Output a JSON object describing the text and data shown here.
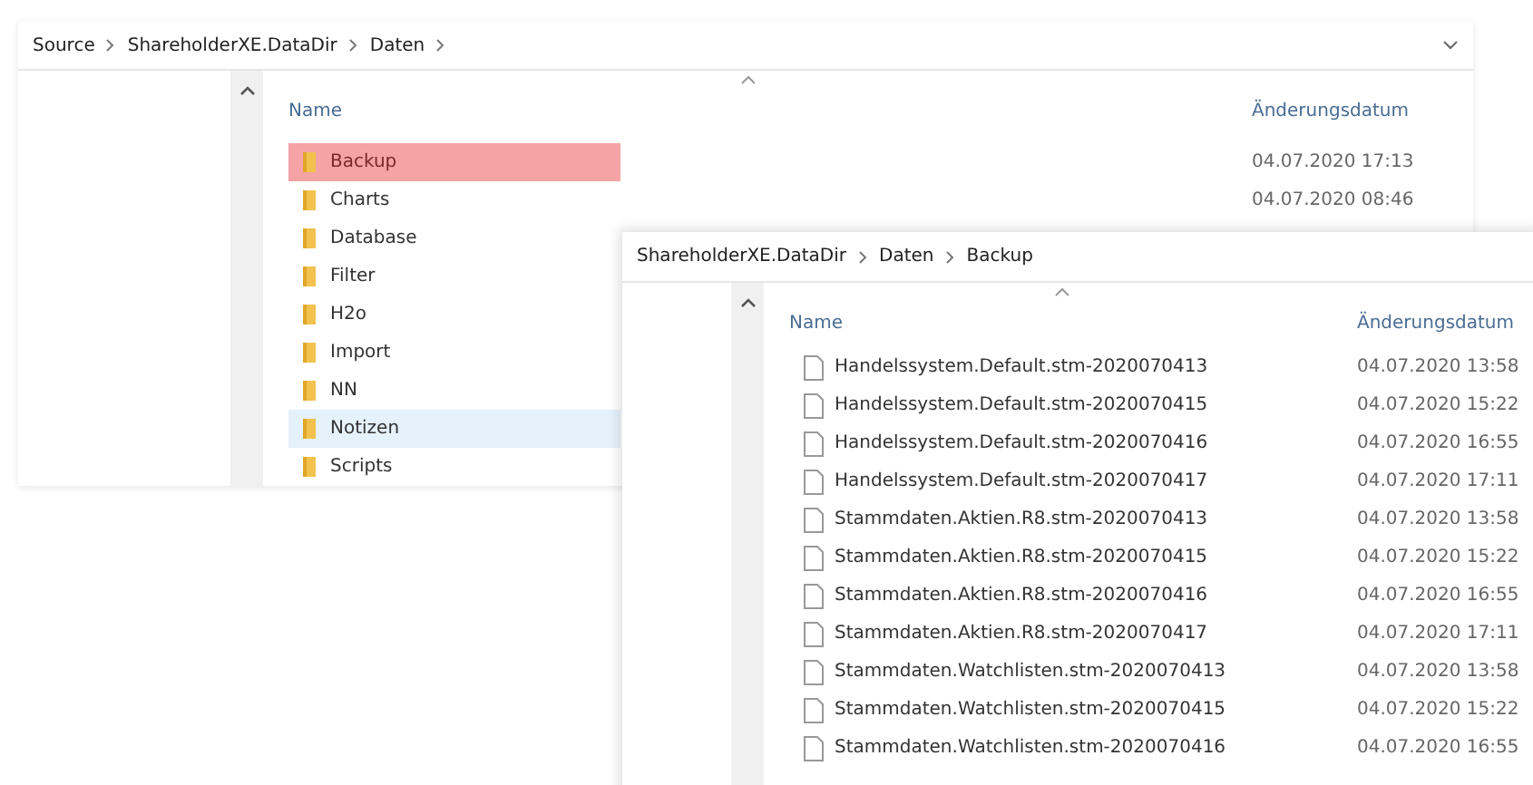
{
  "back_window": {
    "breadcrumb": [
      "Source",
      "ShareholderXE.DataDir",
      "Daten"
    ],
    "columns": [
      "Name",
      "Änderungsdatum"
    ],
    "folders": [
      {
        "name": "Backup",
        "marked": true,
        "selected": false
      },
      {
        "name": "Charts",
        "marked": false,
        "selected": false
      },
      {
        "name": "Database",
        "marked": false,
        "selected": false
      },
      {
        "name": "Filter",
        "marked": false,
        "selected": false
      },
      {
        "name": "H2o",
        "marked": false,
        "selected": false
      },
      {
        "name": "Import",
        "marked": false,
        "selected": false
      },
      {
        "name": "NN",
        "marked": false,
        "selected": false
      },
      {
        "name": "Notizen",
        "marked": false,
        "selected": true
      },
      {
        "name": "Scripts",
        "marked": false,
        "selected": false
      }
    ],
    "dates": [
      "04.07.2020 17:13",
      "04.07.2020 08:46"
    ]
  },
  "front_window": {
    "breadcrumb": [
      "ShareholderXE.DataDir",
      "Daten",
      "Backup"
    ],
    "columns": [
      "Name",
      "Änderungsdatum"
    ],
    "files": [
      {
        "name": "Handelssystem.Default.stm-2020070413",
        "date": "04.07.2020 13:58"
      },
      {
        "name": "Handelssystem.Default.stm-2020070415",
        "date": "04.07.2020 15:22"
      },
      {
        "name": "Handelssystem.Default.stm-2020070416",
        "date": "04.07.2020 16:55"
      },
      {
        "name": "Handelssystem.Default.stm-2020070417",
        "date": "04.07.2020 17:11"
      },
      {
        "name": "Stammdaten.Aktien.R8.stm-2020070413",
        "date": "04.07.2020 13:58"
      },
      {
        "name": "Stammdaten.Aktien.R8.stm-2020070415",
        "date": "04.07.2020 15:22"
      },
      {
        "name": "Stammdaten.Aktien.R8.stm-2020070416",
        "date": "04.07.2020 16:55"
      },
      {
        "name": "Stammdaten.Aktien.R8.stm-2020070417",
        "date": "04.07.2020 17:11"
      },
      {
        "name": "Stammdaten.Watchlisten.stm-2020070413",
        "date": "04.07.2020 13:58"
      },
      {
        "name": "Stammdaten.Watchlisten.stm-2020070415",
        "date": "04.07.2020 15:22"
      },
      {
        "name": "Stammdaten.Watchlisten.stm-2020070416",
        "date": "04.07.2020 16:55"
      }
    ]
  }
}
